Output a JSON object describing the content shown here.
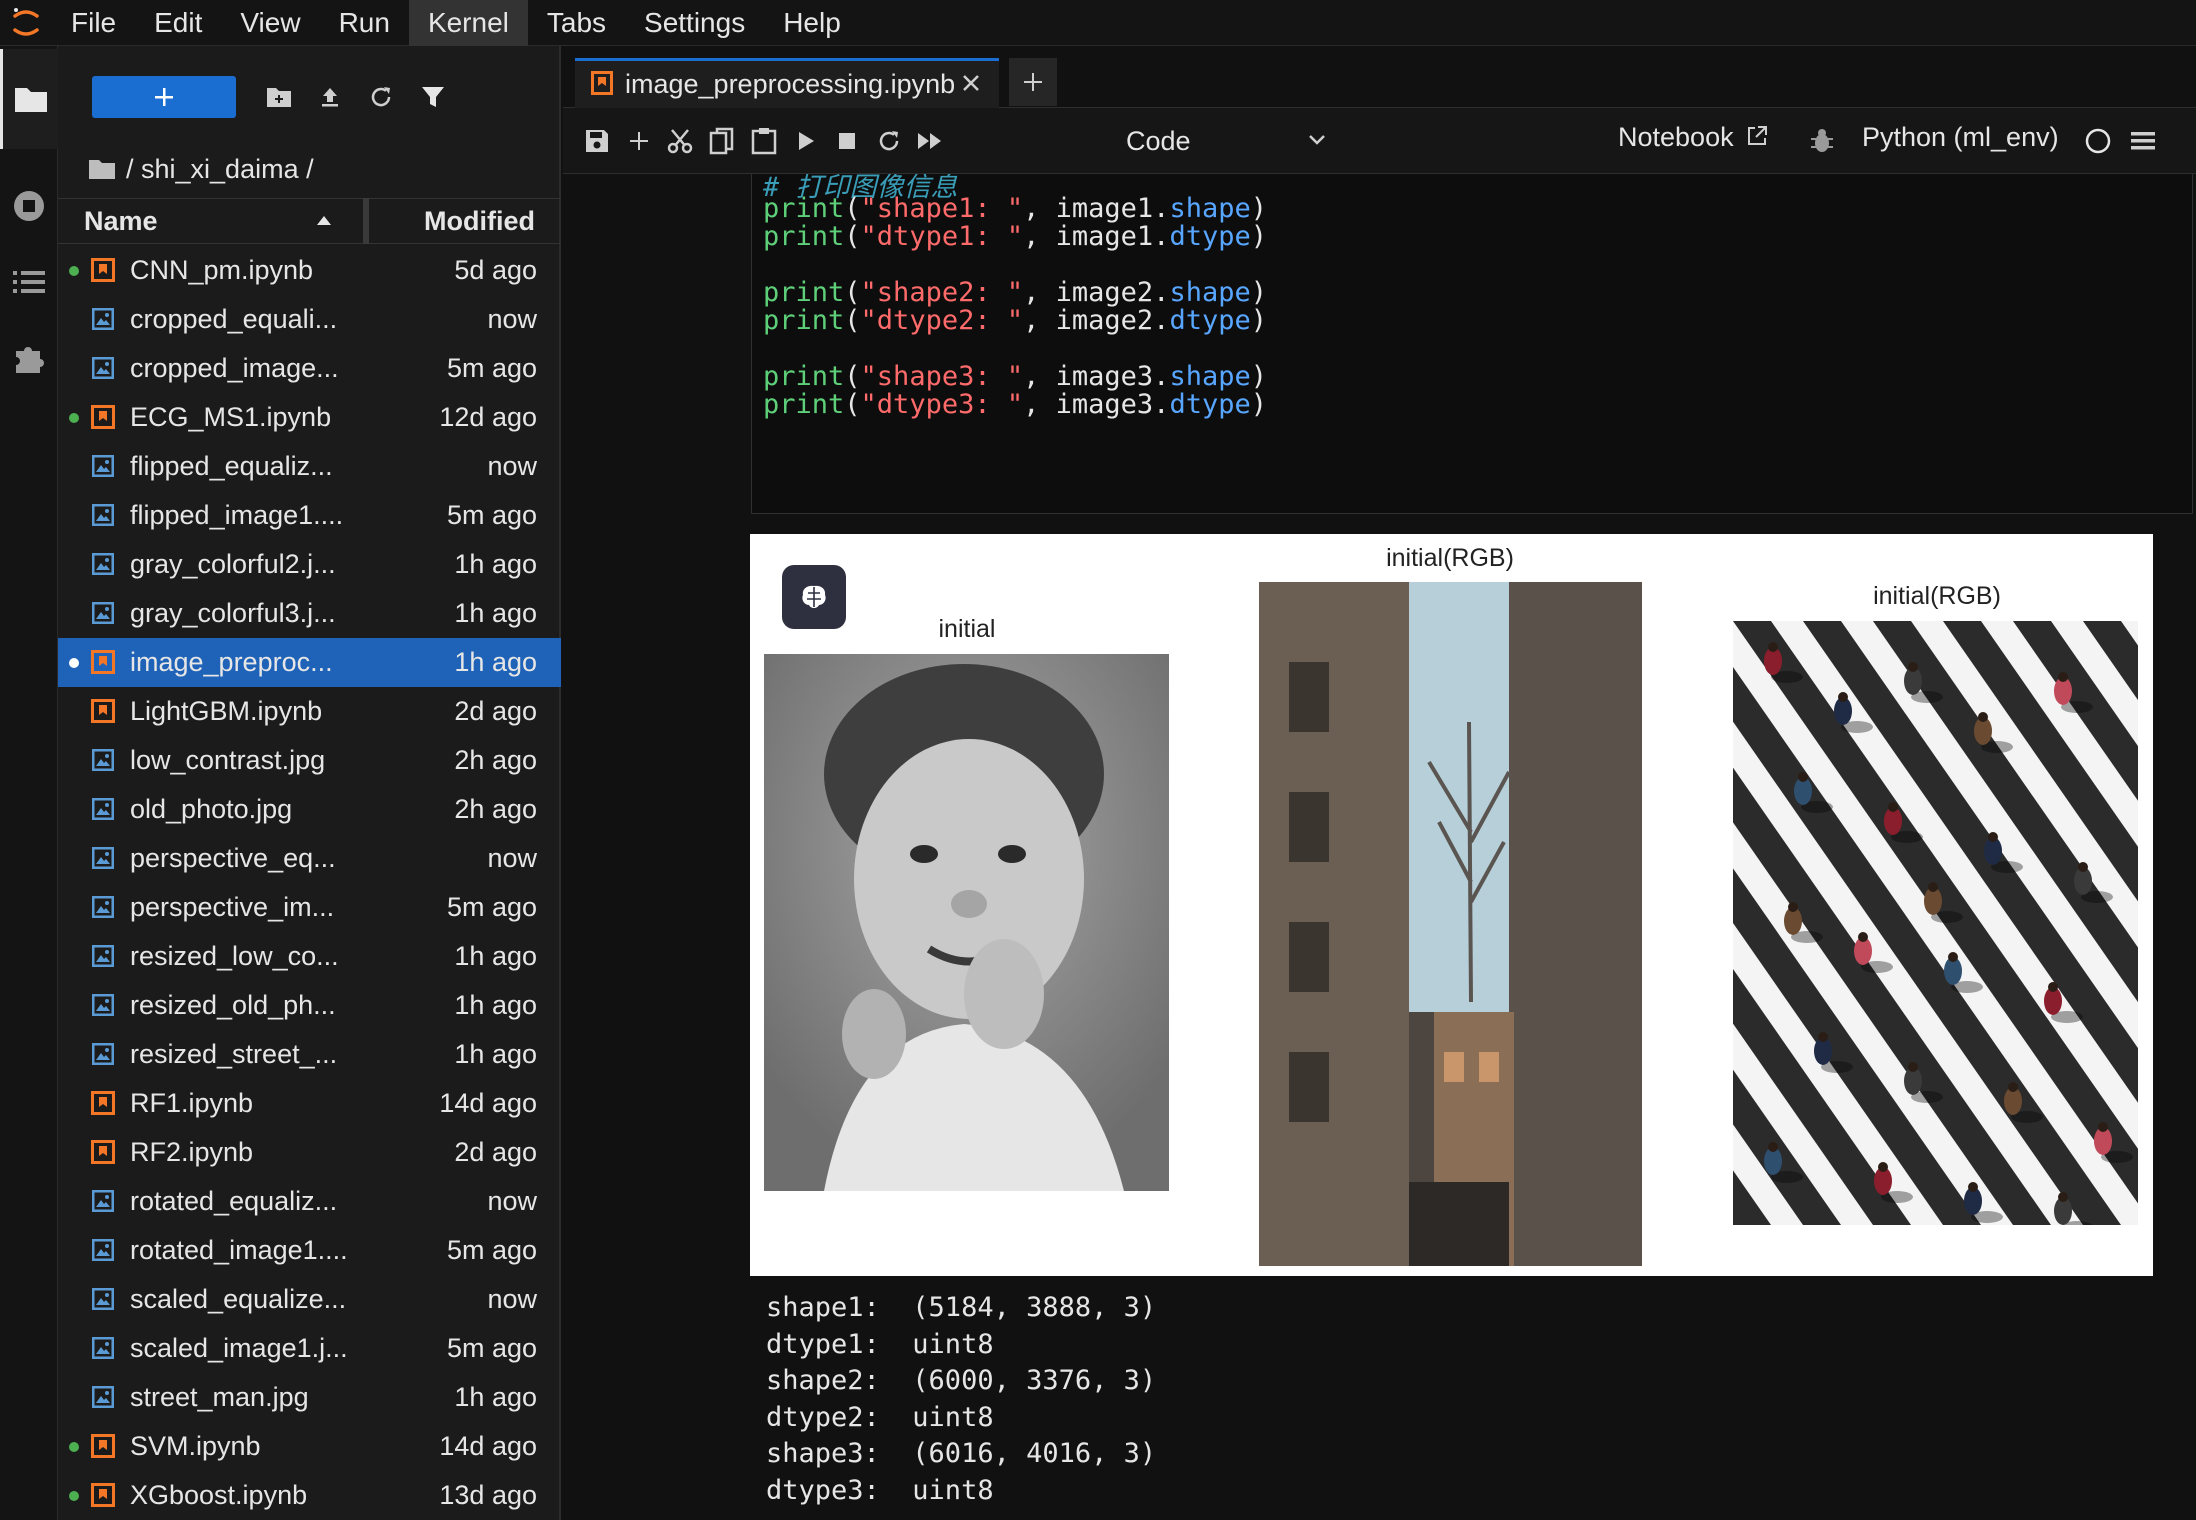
{
  "menubar": {
    "items": [
      "File",
      "Edit",
      "View",
      "Run",
      "Kernel",
      "Tabs",
      "Settings",
      "Help"
    ],
    "active": "Kernel"
  },
  "filebrowser": {
    "breadcrumb": "/ shi_xi_daima /",
    "columns": {
      "name": "Name",
      "modified": "Modified"
    },
    "files": [
      {
        "name": "CNN_pm.ipynb",
        "modified": "5d ago",
        "type": "notebook",
        "running": true
      },
      {
        "name": "cropped_equali...",
        "modified": "now",
        "type": "image",
        "running": false
      },
      {
        "name": "cropped_image...",
        "modified": "5m ago",
        "type": "image",
        "running": false
      },
      {
        "name": "ECG_MS1.ipynb",
        "modified": "12d ago",
        "type": "notebook",
        "running": true
      },
      {
        "name": "flipped_equaliz...",
        "modified": "now",
        "type": "image",
        "running": false
      },
      {
        "name": "flipped_image1....",
        "modified": "5m ago",
        "type": "image",
        "running": false
      },
      {
        "name": "gray_colorful2.j...",
        "modified": "1h ago",
        "type": "image",
        "running": false
      },
      {
        "name": "gray_colorful3.j...",
        "modified": "1h ago",
        "type": "image",
        "running": false
      },
      {
        "name": "image_preproc...",
        "modified": "1h ago",
        "type": "notebook",
        "running": true,
        "selected": true
      },
      {
        "name": "LightGBM.ipynb",
        "modified": "2d ago",
        "type": "notebook",
        "running": false
      },
      {
        "name": "low_contrast.jpg",
        "modified": "2h ago",
        "type": "image",
        "running": false
      },
      {
        "name": "old_photo.jpg",
        "modified": "2h ago",
        "type": "image",
        "running": false
      },
      {
        "name": "perspective_eq...",
        "modified": "now",
        "type": "image",
        "running": false
      },
      {
        "name": "perspective_im...",
        "modified": "5m ago",
        "type": "image",
        "running": false
      },
      {
        "name": "resized_low_co...",
        "modified": "1h ago",
        "type": "image",
        "running": false
      },
      {
        "name": "resized_old_ph...",
        "modified": "1h ago",
        "type": "image",
        "running": false
      },
      {
        "name": "resized_street_...",
        "modified": "1h ago",
        "type": "image",
        "running": false
      },
      {
        "name": "RF1.ipynb",
        "modified": "14d ago",
        "type": "notebook",
        "running": false
      },
      {
        "name": "RF2.ipynb",
        "modified": "2d ago",
        "type": "notebook",
        "running": false
      },
      {
        "name": "rotated_equaliz...",
        "modified": "now",
        "type": "image",
        "running": false
      },
      {
        "name": "rotated_image1....",
        "modified": "5m ago",
        "type": "image",
        "running": false
      },
      {
        "name": "scaled_equalize...",
        "modified": "now",
        "type": "image",
        "running": false
      },
      {
        "name": "scaled_image1.j...",
        "modified": "5m ago",
        "type": "image",
        "running": false
      },
      {
        "name": "street_man.jpg",
        "modified": "1h ago",
        "type": "image",
        "running": false
      },
      {
        "name": "SVM.ipynb",
        "modified": "14d ago",
        "type": "notebook",
        "running": true
      },
      {
        "name": "XGboost.ipynb",
        "modified": "13d ago",
        "type": "notebook",
        "running": true
      }
    ]
  },
  "tab": {
    "label": "image_preprocessing.ipynb"
  },
  "toolbar": {
    "cell_type": "Code",
    "notebook_label": "Notebook",
    "kernel_name": "Python (ml_env)"
  },
  "code_cell": {
    "comment": "# 打印图像信息",
    "lines": [
      {
        "fn": "print",
        "str": "\"shape1: \"",
        "obj": "image1",
        "attr": "shape"
      },
      {
        "fn": "print",
        "str": "\"dtype1: \"",
        "obj": "image1",
        "attr": "dtype"
      },
      {
        "fn": "print",
        "str": "\"shape2: \"",
        "obj": "image2",
        "attr": "shape"
      },
      {
        "fn": "print",
        "str": "\"dtype2: \"",
        "obj": "image2",
        "attr": "dtype"
      },
      {
        "fn": "print",
        "str": "\"shape3: \"",
        "obj": "image3",
        "attr": "shape"
      },
      {
        "fn": "print",
        "str": "\"dtype3: \"",
        "obj": "image3",
        "attr": "dtype"
      }
    ]
  },
  "figure": {
    "titles": [
      "initial",
      "initial(RGB)",
      "initial(RGB)"
    ]
  },
  "stream_output": [
    "shape1:  (5184, 3888, 3)",
    "dtype1:  uint8",
    "shape2:  (6000, 3376, 3)",
    "dtype2:  uint8",
    "shape3:  (6016, 4016, 3)",
    "dtype3:  uint8"
  ],
  "colors": {
    "accent": "#1a6ed1",
    "notebook_icon": "#f37726",
    "image_icon": "#5b9bd5",
    "running_dot": "#4caf50",
    "code_function": "#5fd07a",
    "code_string": "#ff6b6b",
    "code_attribute": "#58a6ff"
  }
}
